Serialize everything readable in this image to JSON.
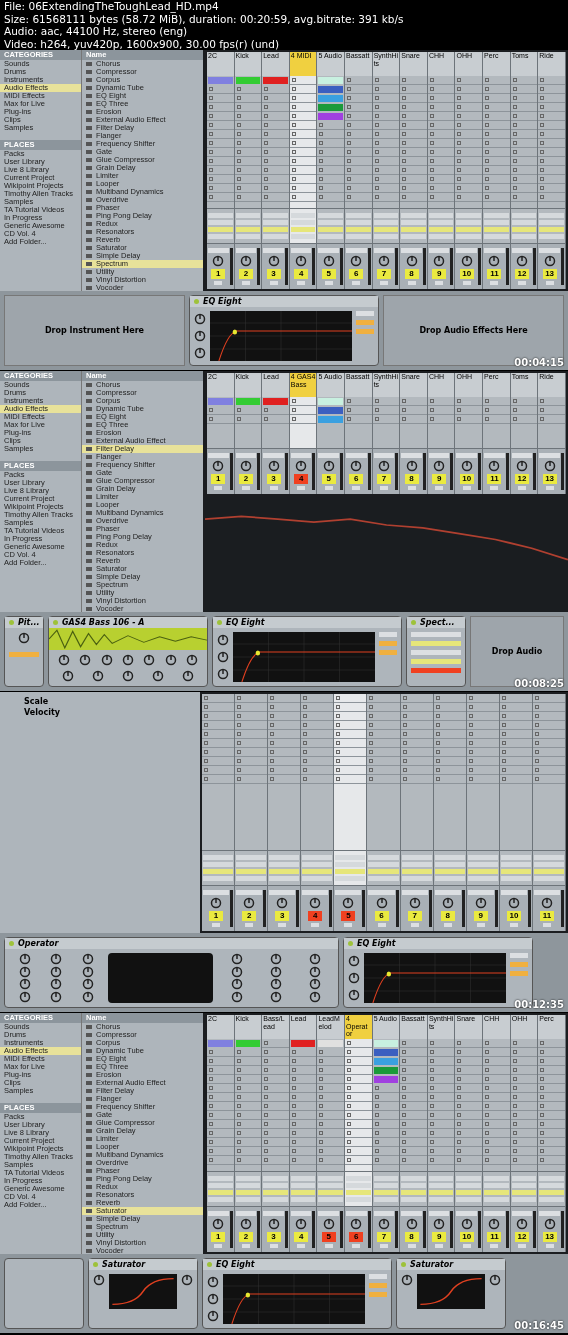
{
  "header": {
    "lines": [
      "File: 06ExtendingTheToughLead_HD.mp4",
      "Size: 61568111 bytes (58.72 MiB), duration: 00:20:59, avg.bitrate: 391 kb/s",
      "Audio: aac, 44100 Hz, stereo (eng)",
      "Video: h264, yuv420p, 1600x900, 30.00 fps(r) (und)"
    ]
  },
  "frames": [
    {
      "kind": "browser",
      "timestamp": "00:04:15",
      "browser": {
        "categories_title": "CATEGORIES",
        "categories": [
          {
            "label": "Sounds",
            "selected": false
          },
          {
            "label": "Drums",
            "selected": false
          },
          {
            "label": "Instruments",
            "selected": false
          },
          {
            "label": "Audio Effects",
            "selected": true
          },
          {
            "label": "MIDI Effects",
            "selected": false
          },
          {
            "label": "Max for Live",
            "selected": false
          },
          {
            "label": "Plug-ins",
            "selected": false
          },
          {
            "label": "Clips",
            "selected": false
          },
          {
            "label": "Samples",
            "selected": false
          }
        ],
        "places_title": "PLACES",
        "places": [
          "Packs",
          "User Library",
          "Live 8 Library",
          "Current Project",
          "Wikipoint Projects",
          "Timothy Allen Tracks",
          "Samples",
          "TA Tutorial Videos",
          "In Progress",
          "Generic Awesome CD Vol. 4",
          "Add Folder..."
        ],
        "list_title": "Name",
        "items": [
          {
            "label": "Chorus",
            "selected": false
          },
          {
            "label": "Compressor",
            "selected": false
          },
          {
            "label": "Corpus",
            "selected": false
          },
          {
            "label": "Dynamic Tube",
            "selected": false
          },
          {
            "label": "EQ Eight",
            "selected": false
          },
          {
            "label": "EQ Three",
            "selected": false
          },
          {
            "label": "Erosion",
            "selected": false
          },
          {
            "label": "External Audio Effect",
            "selected": false
          },
          {
            "label": "Filter Delay",
            "selected": false
          },
          {
            "label": "Flanger",
            "selected": false
          },
          {
            "label": "Frequency Shifter",
            "selected": false
          },
          {
            "label": "Gate",
            "selected": false
          },
          {
            "label": "Glue Compressor",
            "selected": false
          },
          {
            "label": "Grain Delay",
            "selected": false
          },
          {
            "label": "Limiter",
            "selected": false
          },
          {
            "label": "Looper",
            "selected": false
          },
          {
            "label": "Multiband Dynamics",
            "selected": false
          },
          {
            "label": "Overdrive",
            "selected": false
          },
          {
            "label": "Phaser",
            "selected": false
          },
          {
            "label": "Ping Pong Delay",
            "selected": false
          },
          {
            "label": "Redux",
            "selected": false
          },
          {
            "label": "Resonators",
            "selected": false
          },
          {
            "label": "Reverb",
            "selected": false
          },
          {
            "label": "Saturator",
            "selected": false
          },
          {
            "label": "Simple Delay",
            "selected": false
          },
          {
            "label": "Spectrum",
            "selected": true
          },
          {
            "label": "Utility",
            "selected": false
          },
          {
            "label": "Vinyl Distortion",
            "selected": false
          },
          {
            "label": "Vocoder",
            "selected": false
          }
        ]
      },
      "session": {
        "tracks": [
          {
            "name": "2C",
            "number": "1",
            "selected": false,
            "armed": false,
            "clips": [
              {
                "color": "#8080e0"
              }
            ]
          },
          {
            "name": "Kick",
            "number": "2",
            "selected": false,
            "armed": false,
            "clips": [
              {
                "color": "#33cc33"
              }
            ]
          },
          {
            "name": "Lead",
            "number": "3",
            "selected": false,
            "armed": false,
            "clips": [
              {
                "color": "#e02020"
              }
            ]
          },
          {
            "name": "4 MIDI",
            "number": "4",
            "selected": true,
            "armed": false
          },
          {
            "name": "5 Audio",
            "number": "5",
            "selected": false,
            "armed": false,
            "clips": [
              {
                "color": "#c8f0e0"
              },
              {
                "color": "#3b5fc0"
              },
              {
                "color": "#3aa0e0"
              },
              {
                "color": "#1a9a3a"
              },
              {
                "color": "#a040e0"
              }
            ]
          },
          {
            "name": "Bassatt",
            "number": "6",
            "selected": false,
            "armed": false
          },
          {
            "name": "SynthHits",
            "number": "7",
            "selected": false,
            "armed": false
          },
          {
            "name": "Snare",
            "number": "8",
            "selected": false,
            "armed": false
          },
          {
            "name": "CHH",
            "number": "9",
            "selected": false,
            "armed": false
          },
          {
            "name": "OHH",
            "number": "10",
            "selected": false,
            "armed": false
          },
          {
            "name": "Perc",
            "number": "11",
            "selected": false,
            "armed": false
          },
          {
            "name": "Toms",
            "number": "12",
            "selected": false,
            "armed": false
          },
          {
            "name": "Ride",
            "number": "13",
            "selected": false,
            "armed": false
          }
        ]
      },
      "devices": [
        {
          "kind": "drop",
          "title": "Drop Instrument Here"
        },
        {
          "kind": "eq",
          "title": "EQ Eight"
        },
        {
          "kind": "drop",
          "title": "Drop Audio Effects Here"
        }
      ]
    },
    {
      "kind": "spectrum",
      "timestamp": "00:08:25",
      "browser": {
        "categories_title": "CATEGORIES",
        "categories": [
          {
            "label": "Sounds",
            "selected": false
          },
          {
            "label": "Drums",
            "selected": false
          },
          {
            "label": "Instruments",
            "selected": false
          },
          {
            "label": "Audio Effects",
            "selected": true
          },
          {
            "label": "MIDI Effects",
            "selected": false
          },
          {
            "label": "Max for Live",
            "selected": false
          },
          {
            "label": "Plug-ins",
            "selected": false
          },
          {
            "label": "Clips",
            "selected": false
          },
          {
            "label": "Samples",
            "selected": false
          }
        ],
        "places_title": "PLACES",
        "places": [
          "Packs",
          "User Library",
          "Live 8 Library",
          "Current Project",
          "Wikipoint Projects",
          "Timothy Allen Tracks",
          "Samples",
          "TA Tutorial Videos",
          "In Progress",
          "Generic Awesome CD Vol. 4",
          "Add Folder..."
        ],
        "list_title": "Name",
        "items": [
          {
            "label": "Chorus",
            "selected": false
          },
          {
            "label": "Compressor",
            "selected": false
          },
          {
            "label": "Corpus",
            "selected": false
          },
          {
            "label": "Dynamic Tube",
            "selected": false
          },
          {
            "label": "EQ Eight",
            "selected": false
          },
          {
            "label": "EQ Three",
            "selected": false
          },
          {
            "label": "Erosion",
            "selected": false
          },
          {
            "label": "External Audio Effect",
            "selected": false
          },
          {
            "label": "Filter Delay",
            "selected": true
          },
          {
            "label": "Flanger",
            "selected": false
          },
          {
            "label": "Frequency Shifter",
            "selected": false
          },
          {
            "label": "Gate",
            "selected": false
          },
          {
            "label": "Glue Compressor",
            "selected": false
          },
          {
            "label": "Grain Delay",
            "selected": false
          },
          {
            "label": "Limiter",
            "selected": false
          },
          {
            "label": "Looper",
            "selected": false
          },
          {
            "label": "Multiband Dynamics",
            "selected": false
          },
          {
            "label": "Overdrive",
            "selected": false
          },
          {
            "label": "Phaser",
            "selected": false
          },
          {
            "label": "Ping Pong Delay",
            "selected": false
          },
          {
            "label": "Redux",
            "selected": false
          },
          {
            "label": "Resonators",
            "selected": false
          },
          {
            "label": "Reverb",
            "selected": false
          },
          {
            "label": "Saturator",
            "selected": false
          },
          {
            "label": "Simple Delay",
            "selected": false
          },
          {
            "label": "Spectrum",
            "selected": false
          },
          {
            "label": "Utility",
            "selected": false
          },
          {
            "label": "Vinyl Distortion",
            "selected": false
          },
          {
            "label": "Vocoder",
            "selected": false
          }
        ]
      },
      "session": {
        "tracks": [
          {
            "name": "2C",
            "number": "1",
            "selected": false,
            "armed": false,
            "clips": [
              {
                "color": "#8080e0"
              }
            ]
          },
          {
            "name": "Kick",
            "number": "2",
            "selected": false,
            "armed": false,
            "clips": [
              {
                "color": "#33cc33"
              }
            ]
          },
          {
            "name": "Lead",
            "number": "3",
            "selected": false,
            "armed": false,
            "clips": [
              {
                "color": "#e02020"
              }
            ]
          },
          {
            "name": "4 GAS4 Bass",
            "number": "4",
            "selected": true,
            "armed": true
          },
          {
            "name": "5 Audio",
            "number": "5",
            "selected": false,
            "armed": false,
            "clips": [
              {
                "color": "#c8f0e0"
              },
              {
                "color": "#3b5fc0"
              },
              {
                "color": "#3aa0e0"
              }
            ]
          },
          {
            "name": "Bassatt",
            "number": "6",
            "selected": false,
            "armed": false
          },
          {
            "name": "SynthHits",
            "number": "7",
            "selected": false,
            "armed": false
          },
          {
            "name": "Snare",
            "number": "8",
            "selected": false,
            "armed": false
          },
          {
            "name": "CHH",
            "number": "9",
            "selected": false,
            "armed": false
          },
          {
            "name": "OHH",
            "number": "10",
            "selected": false,
            "armed": false
          },
          {
            "name": "Perc",
            "number": "11",
            "selected": false,
            "armed": false
          },
          {
            "name": "Toms",
            "number": "12",
            "selected": false,
            "armed": false
          },
          {
            "name": "Ride",
            "number": "13",
            "selected": false,
            "armed": false
          }
        ]
      },
      "devices": [
        {
          "kind": "pitch",
          "title": "Pit..."
        },
        {
          "kind": "sampler",
          "title": "GAS4 Bass 106 - A"
        },
        {
          "kind": "eq",
          "title": "EQ Eight"
        },
        {
          "kind": "spectrum",
          "title": "Spect..."
        },
        {
          "kind": "drop",
          "title": "Drop Audio"
        }
      ]
    },
    {
      "kind": "panel",
      "timestamp": "00:12:35",
      "panel": {
        "items": [
          "Scale",
          "Velocity"
        ]
      },
      "session": {
        "tracks": [
          {
            "number": "1",
            "selected": false,
            "armed": false
          },
          {
            "number": "2",
            "selected": false,
            "armed": false
          },
          {
            "number": "3",
            "selected": false,
            "armed": false
          },
          {
            "number": "4",
            "selected": false,
            "armed": true
          },
          {
            "number": "5",
            "selected": true,
            "armed": true
          },
          {
            "number": "6",
            "selected": false,
            "armed": false
          },
          {
            "number": "7",
            "selected": false,
            "armed": false
          },
          {
            "number": "8",
            "selected": false,
            "armed": false
          },
          {
            "number": "9",
            "selected": false,
            "armed": false
          },
          {
            "number": "10",
            "selected": false,
            "armed": false
          },
          {
            "number": "11",
            "selected": false,
            "armed": false
          }
        ]
      },
      "devices": [
        {
          "kind": "operator",
          "title": "Operator"
        },
        {
          "kind": "eq",
          "title": "EQ Eight"
        }
      ]
    },
    {
      "kind": "browser",
      "timestamp": "00:16:45",
      "browser": {
        "categories_title": "CATEGORIES",
        "categories": [
          {
            "label": "Sounds",
            "selected": false
          },
          {
            "label": "Drums",
            "selected": false
          },
          {
            "label": "Instruments",
            "selected": false
          },
          {
            "label": "Audio Effects",
            "selected": true
          },
          {
            "label": "MIDI Effects",
            "selected": false
          },
          {
            "label": "Max for Live",
            "selected": false
          },
          {
            "label": "Plug-ins",
            "selected": false
          },
          {
            "label": "Clips",
            "selected": false
          },
          {
            "label": "Samples",
            "selected": false
          }
        ],
        "places_title": "PLACES",
        "places": [
          "Packs",
          "User Library",
          "Live 8 Library",
          "Current Project",
          "Wikipoint Projects",
          "Timothy Allen Tracks",
          "Samples",
          "TA Tutorial Videos",
          "In Progress",
          "Generic Awesome CD Vol. 4",
          "Add Folder..."
        ],
        "list_title": "Name",
        "items": [
          {
            "label": "Chorus",
            "selected": false
          },
          {
            "label": "Compressor",
            "selected": false
          },
          {
            "label": "Corpus",
            "selected": false
          },
          {
            "label": "Dynamic Tube",
            "selected": false
          },
          {
            "label": "EQ Eight",
            "selected": false
          },
          {
            "label": "EQ Three",
            "selected": false
          },
          {
            "label": "Erosion",
            "selected": false
          },
          {
            "label": "External Audio Effect",
            "selected": false
          },
          {
            "label": "Filter Delay",
            "selected": false
          },
          {
            "label": "Flanger",
            "selected": false
          },
          {
            "label": "Frequency Shifter",
            "selected": false
          },
          {
            "label": "Gate",
            "selected": false
          },
          {
            "label": "Glue Compressor",
            "selected": false
          },
          {
            "label": "Grain Delay",
            "selected": false
          },
          {
            "label": "Limiter",
            "selected": false
          },
          {
            "label": "Looper",
            "selected": false
          },
          {
            "label": "Multiband Dynamics",
            "selected": false
          },
          {
            "label": "Overdrive",
            "selected": false
          },
          {
            "label": "Phaser",
            "selected": false
          },
          {
            "label": "Ping Pong Delay",
            "selected": false
          },
          {
            "label": "Redux",
            "selected": false
          },
          {
            "label": "Resonators",
            "selected": false
          },
          {
            "label": "Reverb",
            "selected": false
          },
          {
            "label": "Saturator",
            "selected": true
          },
          {
            "label": "Simple Delay",
            "selected": false
          },
          {
            "label": "Spectrum",
            "selected": false
          },
          {
            "label": "Utility",
            "selected": false
          },
          {
            "label": "Vinyl Distortion",
            "selected": false
          },
          {
            "label": "Vocoder",
            "selected": false
          }
        ]
      },
      "session": {
        "tracks": [
          {
            "name": "2C",
            "number": "1",
            "selected": false,
            "armed": false,
            "clips": [
              {
                "color": "#8080e0"
              }
            ]
          },
          {
            "name": "Kick",
            "number": "2",
            "selected": false,
            "armed": false,
            "clips": [
              {
                "color": "#33cc33"
              }
            ]
          },
          {
            "name": "Bass/Lead",
            "number": "3",
            "selected": false,
            "armed": false
          },
          {
            "name": "Lead",
            "number": "4",
            "selected": false,
            "armed": false,
            "clips": [
              {
                "color": "#e02020"
              }
            ]
          },
          {
            "name": "LeadMelod",
            "number": "5",
            "selected": false,
            "armed": true,
            "clips": [
              {
                "color": "#e0e0e0"
              }
            ]
          },
          {
            "name": "4 Operator",
            "number": "6",
            "selected": true,
            "armed": true
          },
          {
            "name": "5 Audio",
            "number": "7",
            "selected": false,
            "armed": false,
            "clips": [
              {
                "color": "#c8f0e0"
              },
              {
                "color": "#3b5fc0"
              },
              {
                "color": "#3aa0e0"
              },
              {
                "color": "#1a9a3a"
              },
              {
                "color": "#a040e0"
              }
            ]
          },
          {
            "name": "Bassatt",
            "number": "8",
            "selected": false,
            "armed": false
          },
          {
            "name": "SynthHits",
            "number": "9",
            "selected": false,
            "armed": false
          },
          {
            "name": "Snare",
            "number": "10",
            "selected": false,
            "armed": false
          },
          {
            "name": "CHH",
            "number": "11",
            "selected": false,
            "armed": false
          },
          {
            "name": "OHH",
            "number": "12",
            "selected": false,
            "armed": false
          },
          {
            "name": "Perc",
            "number": "13",
            "selected": false,
            "armed": false
          }
        ]
      },
      "devices": [
        {
          "kind": "generic"
        },
        {
          "kind": "saturator",
          "title": "Saturator"
        },
        {
          "kind": "eq",
          "title": "EQ Eight"
        },
        {
          "kind": "saturator",
          "title": "Saturator"
        }
      ]
    }
  ]
}
